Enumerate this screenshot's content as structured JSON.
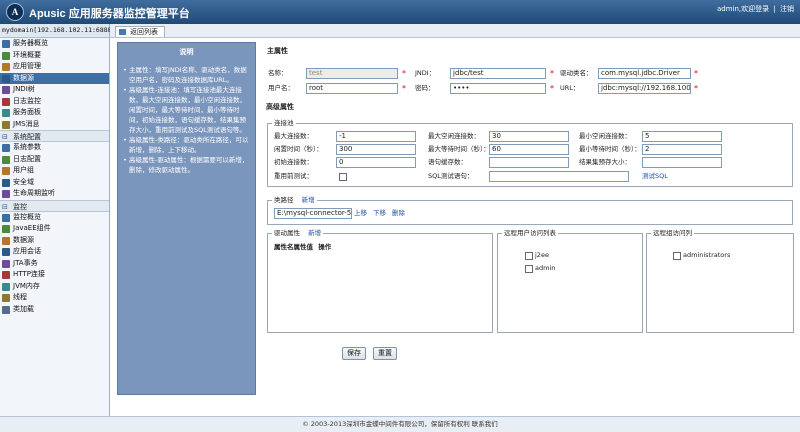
{
  "header": {
    "logo_letter": "A",
    "brand": "Apusic 应用服务器监控管理平台",
    "user": "admin,欢迎登录",
    "separator": "|",
    "logout": "注销"
  },
  "sidebar": {
    "domain": "mydomain[192.168.102.11:6888]",
    "items_top": [
      {
        "label": "服务器概览",
        "icon": "server-icon"
      },
      {
        "label": "环境概要",
        "icon": "env-icon"
      },
      {
        "label": "应用管理",
        "icon": "app-icon"
      },
      {
        "label": "数据源",
        "icon": "datasource-icon"
      },
      {
        "label": "JNDI树",
        "icon": "tree-icon"
      },
      {
        "label": "日志监控",
        "icon": "log-icon"
      },
      {
        "label": "服务面板",
        "icon": "panel-icon"
      },
      {
        "label": "JMS消息",
        "icon": "message-icon"
      }
    ],
    "group_config": "系统配置",
    "items_config": [
      {
        "label": "系统参数",
        "icon": "params-icon"
      },
      {
        "label": "日志配置",
        "icon": "log-config-icon"
      },
      {
        "label": "用户组",
        "icon": "users-icon"
      },
      {
        "label": "安全域",
        "icon": "security-icon"
      },
      {
        "label": "生命周期监听",
        "icon": "lifecycle-icon"
      }
    ],
    "group_monitor": "监控",
    "items_monitor": [
      {
        "label": "监控概览",
        "icon": "monitor-icon"
      },
      {
        "label": "JavaEE组件",
        "icon": "component-icon"
      },
      {
        "label": "数据源",
        "icon": "db-icon"
      },
      {
        "label": "应用会话",
        "icon": "session-icon"
      },
      {
        "label": "JTA事务",
        "icon": "transaction-icon"
      },
      {
        "label": "HTTP连接",
        "icon": "http-icon"
      },
      {
        "label": "JVM内存",
        "icon": "memory-icon"
      },
      {
        "label": "线程",
        "icon": "thread-icon"
      },
      {
        "label": "类加载",
        "icon": "classload-icon"
      }
    ]
  },
  "tab": {
    "back": "返回列表"
  },
  "help": {
    "title": "说明",
    "items": [
      "主属性：填写JNDI名称、驱动类名，数据空用户名，密码及连接数据库URL。",
      "高级属性-连接池：填写连接池最大连接数，最大空闲连接数，最小空闲连接数，闲置时间，最大等待时间，最小等待时间，初始连接数，语句缓存数，结果集预存大小，重用前测试及SQL测试语句等。",
      "高级属性-类路径：驱动类所在路径，可以新增，删除，上下移动。",
      "高级属性-驱动属性：根据需要可以新增，删除，修改驱动属性。"
    ]
  },
  "main_props": {
    "title": "主属性",
    "name_label": "名称：",
    "name_value": "test",
    "jndi_label": "JNDI：",
    "jndi_value": "jdbc/test",
    "driver_label": "驱动类名：",
    "driver_value": "com.mysql.jdbc.Driver",
    "user_label": "用户名：",
    "user_value": "root",
    "password_label": "密码：",
    "password_value": "••••",
    "url_label": "URL：",
    "url_value": "jdbc:mysql://192.168.100",
    "required": "*"
  },
  "advanced": {
    "title": "高级属性",
    "pool": {
      "legend": "连接池",
      "max_conn_label": "最大连接数：",
      "max_conn": "-1",
      "max_idle_label": "最大空闲连接数：",
      "max_idle": "30",
      "min_idle_label": "最小空闲连接数：",
      "min_idle": "5",
      "idle_time_label": "闲置时间（秒）：",
      "idle_time": "300",
      "max_wait_label": "最大等待时间（秒）：",
      "max_wait": "60",
      "min_wait_label": "最小等待时间（秒）：",
      "min_wait": "2",
      "init_conn_label": "初始连接数：",
      "init_conn": "0",
      "stmt_cache_label": "语句缓存数：",
      "stmt_cache": "",
      "result_cache_label": "结果集预存大小：",
      "result_cache": "",
      "test_before_label": "重用前测试：",
      "sql_test_label": "SQL测试语句：",
      "sql_test": "",
      "test_sql_link": "测试SQL"
    },
    "classpath": {
      "legend": "类路径",
      "add": "新增",
      "value": "E:\\mysql-connector-5",
      "up": "上移",
      "down": "下移",
      "delete": "删除"
    },
    "driver_props": {
      "legend": "驱动属性",
      "add": "新增",
      "col_name": "属性名",
      "col_value": "属性值",
      "col_op": "操作"
    },
    "remote_users": {
      "legend": "远程用户访问列表",
      "items": [
        "j2ee",
        "admin"
      ]
    },
    "remote_groups": {
      "legend": "远程组访问列",
      "items": [
        "administrators"
      ]
    }
  },
  "buttons": {
    "save": "保存",
    "reset": "重置"
  },
  "footer": "© 2003-2013深圳市金蝶中间件有限公司，保留所有权利  联系我们"
}
